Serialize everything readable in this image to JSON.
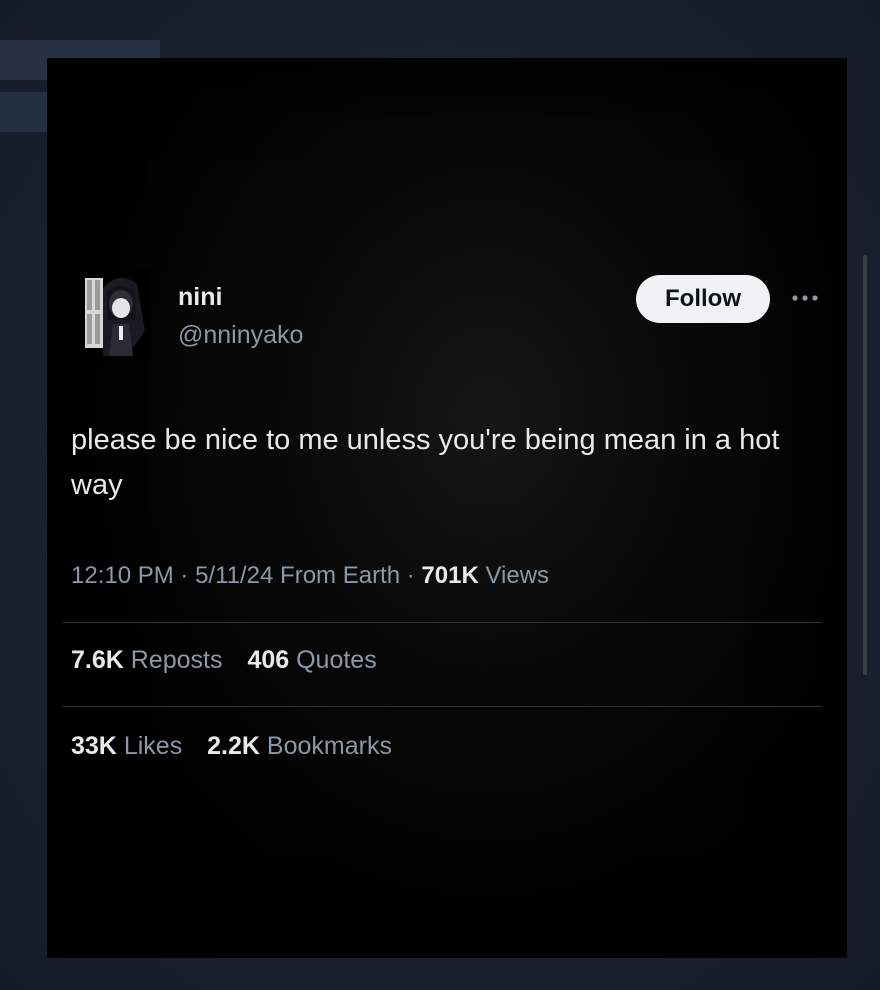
{
  "tweet": {
    "display_name": "nini",
    "handle": "@nninyako",
    "follow_label": "Follow",
    "text": "please be nice to me unless you're being mean in a hot way",
    "time": "12:10 PM",
    "date": "5/11/24",
    "source": "From Earth",
    "views_count": "701K",
    "views_label": "Views",
    "reposts_count": "7.6K",
    "reposts_label": "Reposts",
    "quotes_count": "406",
    "quotes_label": "Quotes",
    "likes_count": "33K",
    "likes_label": "Likes",
    "bookmarks_count": "2.2K",
    "bookmarks_label": "Bookmarks",
    "separator": "·"
  },
  "icons": {
    "more": "more-horizontal-icon",
    "avatar": "avatar-image"
  },
  "colors": {
    "background": "#000000",
    "text_primary": "#e7e9ea",
    "text_secondary": "#8b98a5",
    "follow_bg": "#eff3f4",
    "divider": "#2f3336"
  }
}
